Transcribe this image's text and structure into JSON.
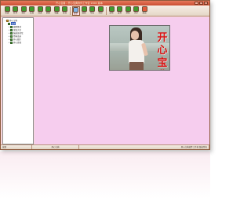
{
  "window": {
    "title": "开心宝典 - 开心宝典软件工作室 2004 版本",
    "controls": [
      "_",
      "□",
      "×"
    ]
  },
  "toolbar": {
    "buttons": [
      {
        "label": "新建",
        "icon": "new-icon",
        "color": "#3f9a2e"
      },
      {
        "label": "打开",
        "icon": "open-icon",
        "color": "#3f9a2e"
      },
      {
        "label": "保存",
        "icon": "save-icon",
        "color": "#3f9a2e"
      },
      {
        "label": "后退",
        "icon": "back-icon",
        "color": "#3f9a2e"
      },
      {
        "label": "前进",
        "icon": "forward-icon",
        "color": "#3f9a2e"
      },
      {
        "label": "刷新",
        "icon": "refresh-icon",
        "color": "#3f9a2e"
      },
      {
        "label": "收藏",
        "icon": "favorite-icon",
        "color": "#3f9a2e"
      },
      {
        "label": "查找",
        "icon": "find-icon",
        "color": "#3f9a2e"
      },
      {
        "label": "显示",
        "icon": "view-icon",
        "color": "#7db4e8",
        "active": true
      },
      {
        "label": "编辑",
        "icon": "edit-icon",
        "color": "#3f9a2e"
      },
      {
        "label": "导出",
        "icon": "export-icon",
        "color": "#3f9a2e"
      },
      {
        "label": "打印",
        "icon": "print-icon",
        "color": "#3f9a2e"
      },
      {
        "label": "选项",
        "icon": "options-icon",
        "color": "#3f9a2e"
      },
      {
        "label": "设置",
        "icon": "settings-icon",
        "color": "#3f9a2e"
      },
      {
        "label": "帮助",
        "icon": "help-icon",
        "color": "#3f9a2e"
      },
      {
        "label": "关于",
        "icon": "about-icon",
        "color": "#3f9a2e"
      },
      {
        "label": "退出",
        "icon": "exit-icon",
        "color": "#e25a3a"
      }
    ]
  },
  "sidebar": {
    "items": [
      {
        "label": "开心宝典",
        "kind": "root",
        "twisty": "−"
      },
      {
        "label": "首页",
        "kind": "child",
        "selected": true,
        "twisty": ""
      },
      {
        "label": "幽默笑话",
        "kind": "sub",
        "twisty": "+"
      },
      {
        "label": "谜语大全",
        "kind": "sub",
        "twisty": "+"
      },
      {
        "label": "脑筋急转弯",
        "kind": "sub",
        "twisty": "+"
      },
      {
        "label": "经典语录",
        "kind": "sub",
        "twisty": "+"
      },
      {
        "label": "开心图片",
        "kind": "sub",
        "twisty": "+"
      },
      {
        "label": "开心游戏",
        "kind": "sub",
        "twisty": "+"
      }
    ]
  },
  "content": {
    "image_caption": "开心宝典"
  },
  "statusbar": {
    "left": "就绪",
    "middle": "开心宝典",
    "right": "开心宝典软件工作室 版权所有"
  }
}
